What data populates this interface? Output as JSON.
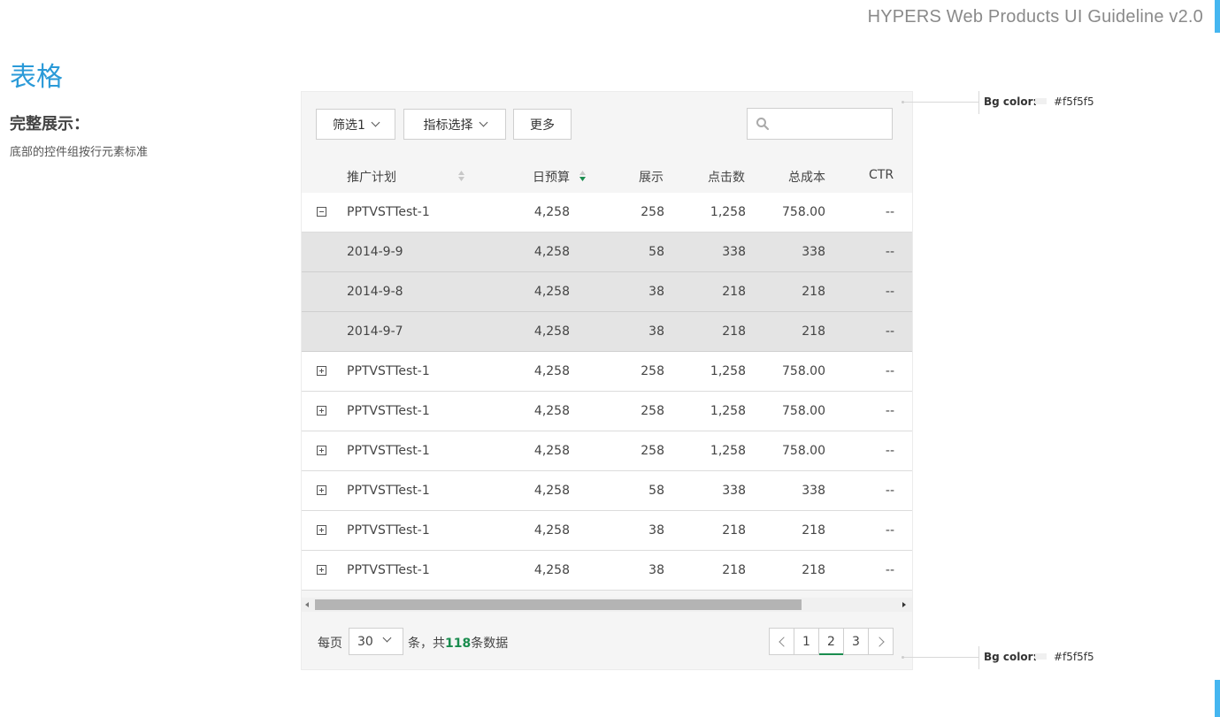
{
  "guideline_title": "HYPERS Web Products UI Guideline v2.0",
  "page_title": "表格",
  "section_title": "完整展示：",
  "section_desc": "底部的控件组按行元素标准",
  "toolbar": {
    "filter1_label": "筛选1",
    "metric_label": "指标选择",
    "more_label": "更多",
    "search_placeholder": ""
  },
  "table": {
    "columns": [
      "推广计划",
      "日预算",
      "展示",
      "点击数",
      "总成本",
      "CTR"
    ],
    "rows": [
      {
        "kind": "parent",
        "expanded": true,
        "name": "PPTVSTTest-1",
        "budget": "4,258",
        "impressions": "258",
        "clicks": "1,258",
        "cost": "758.00",
        "ctr": "--"
      },
      {
        "kind": "child",
        "name": "2014-9-9",
        "budget": "4,258",
        "impressions": "58",
        "clicks": "338",
        "cost": "338",
        "ctr": "--"
      },
      {
        "kind": "child",
        "name": "2014-9-8",
        "budget": "4,258",
        "impressions": "38",
        "clicks": "218",
        "cost": "218",
        "ctr": "--"
      },
      {
        "kind": "child",
        "name": "2014-9-7",
        "budget": "4,258",
        "impressions": "38",
        "clicks": "218",
        "cost": "218",
        "ctr": "--"
      },
      {
        "kind": "parent",
        "expanded": false,
        "name": "PPTVSTTest-1",
        "budget": "4,258",
        "impressions": "258",
        "clicks": "1,258",
        "cost": "758.00",
        "ctr": "--"
      },
      {
        "kind": "parent",
        "expanded": false,
        "name": "PPTVSTTest-1",
        "budget": "4,258",
        "impressions": "258",
        "clicks": "1,258",
        "cost": "758.00",
        "ctr": "--"
      },
      {
        "kind": "parent",
        "expanded": false,
        "name": "PPTVSTTest-1",
        "budget": "4,258",
        "impressions": "258",
        "clicks": "1,258",
        "cost": "758.00",
        "ctr": "--"
      },
      {
        "kind": "parent",
        "expanded": false,
        "name": "PPTVSTTest-1",
        "budget": "4,258",
        "impressions": "58",
        "clicks": "338",
        "cost": "338",
        "ctr": "--"
      },
      {
        "kind": "parent",
        "expanded": false,
        "name": "PPTVSTTest-1",
        "budget": "4,258",
        "impressions": "38",
        "clicks": "218",
        "cost": "218",
        "ctr": "--"
      },
      {
        "kind": "parent",
        "expanded": false,
        "name": "PPTVSTTest-1",
        "budget": "4,258",
        "impressions": "38",
        "clicks": "218",
        "cost": "218",
        "ctr": "--"
      }
    ]
  },
  "footer": {
    "per_page_label": "每页",
    "per_page_value": "30",
    "total_prefix": "条，共",
    "total_count": "118",
    "total_suffix": "条数据",
    "pages": [
      "1",
      "2",
      "3"
    ],
    "active_page": "2"
  },
  "annotations": [
    {
      "label": "Bg color:",
      "hex": "#f5f5f5"
    },
    {
      "label": "Bg color:",
      "hex": "#f5f5f5"
    }
  ],
  "colors": {
    "accent": "#45b6f0",
    "title_blue": "#2a9ad8",
    "active_green": "#1a8c4e",
    "panel_bg": "#f5f5f5",
    "child_row_bg": "#e4e4e4"
  }
}
